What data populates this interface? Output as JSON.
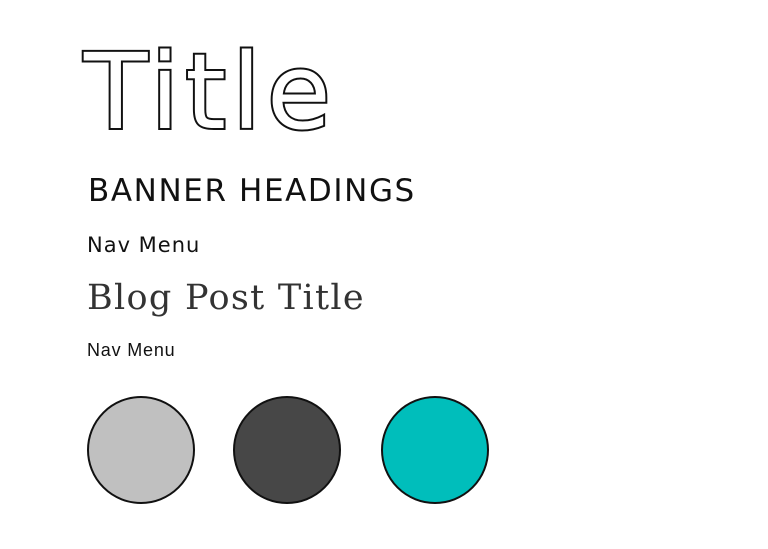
{
  "typography": {
    "title": "Title",
    "banner_heading": "BANNER HEADINGS",
    "nav_menu_large": "Nav Menu",
    "blog_post_title": "Blog Post Title",
    "nav_menu_small": "Nav Menu"
  },
  "palette": {
    "swatches": [
      {
        "color": "#c0c0c0"
      },
      {
        "color": "#474747"
      },
      {
        "color": "#00bebb"
      }
    ]
  }
}
